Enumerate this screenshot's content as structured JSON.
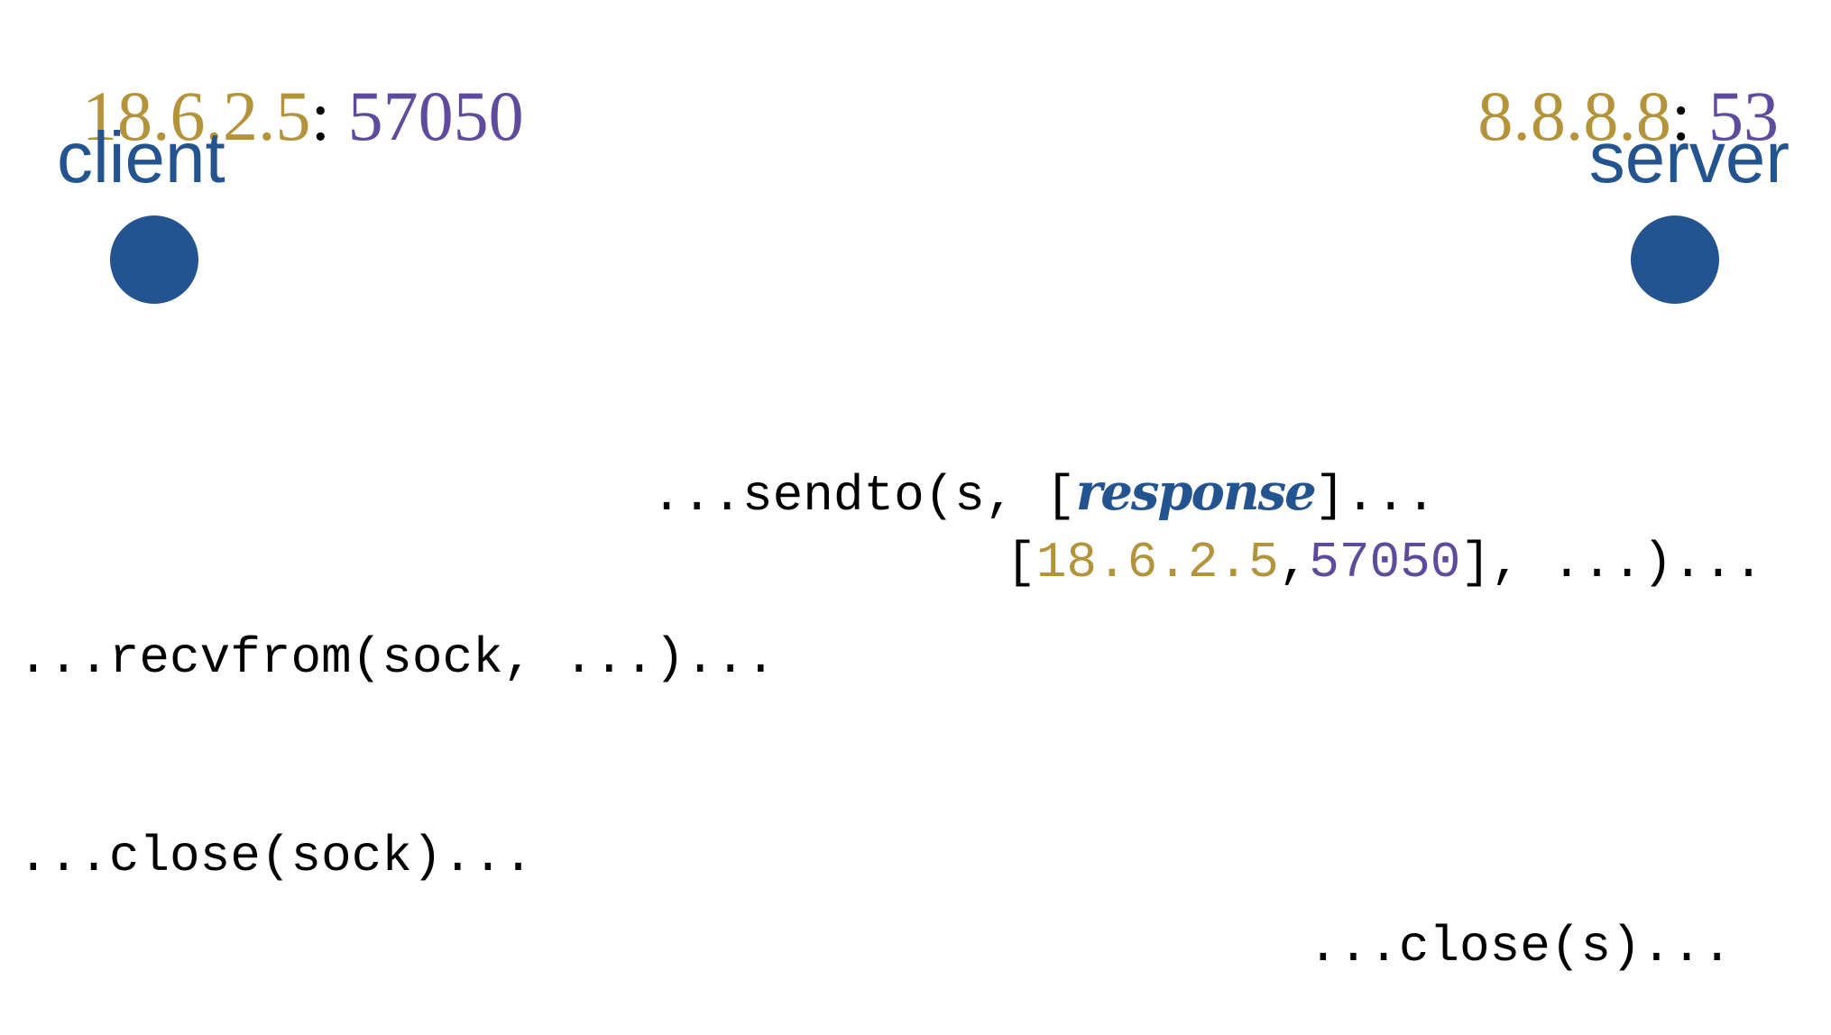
{
  "colors": {
    "ip": "#B5933A",
    "port": "#5F4B9E",
    "role": "#24548F",
    "code": "#000000",
    "keyword": "#24548F"
  },
  "client": {
    "ip": "18.6.2.5",
    "separator": ":",
    "port": "57050",
    "label": "client",
    "node_icon": "filled-circle"
  },
  "server": {
    "ip": "8.8.8.8",
    "separator": ":",
    "port": "53",
    "label": "server",
    "node_icon": "filled-circle"
  },
  "calls": {
    "sendto_prefix": "...sendto(s, [",
    "sendto_payload": "response",
    "sendto_suffix": "]...",
    "sendto_line2_open": "[",
    "sendto_ip": "18.6.2.5",
    "sendto_comma": ",",
    "sendto_port": "57050",
    "sendto_line2_close": "], ...)...",
    "recvfrom": "...recvfrom(sock, ...)...",
    "client_close": "...close(sock)...",
    "server_close": "...close(s)..."
  }
}
